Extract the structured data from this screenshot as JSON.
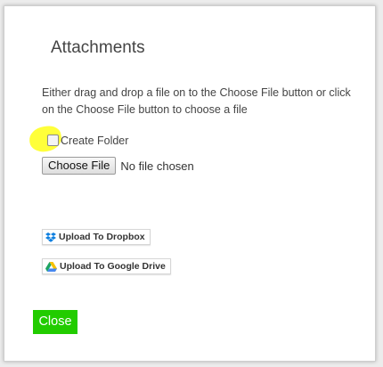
{
  "dialog": {
    "title": "Attachments",
    "instructions": "Either drag and drop a file on to the Choose File button or click on the Choose File button to choose a file",
    "create_folder_label": "Create Folder",
    "create_folder_checked": false,
    "file_input": {
      "button_label": "Choose File",
      "status": "No file chosen"
    },
    "upload_dropbox_label": "Upload To Dropbox",
    "upload_gdrive_label": "Upload To Google Drive",
    "close_label": "Close"
  },
  "colors": {
    "highlight": "#ffff3a",
    "close_button": "#22cc00",
    "dropbox_icon": "#0d7fe0"
  },
  "icons": {
    "dropbox": "dropbox-icon",
    "google_drive": "google-drive-icon"
  }
}
